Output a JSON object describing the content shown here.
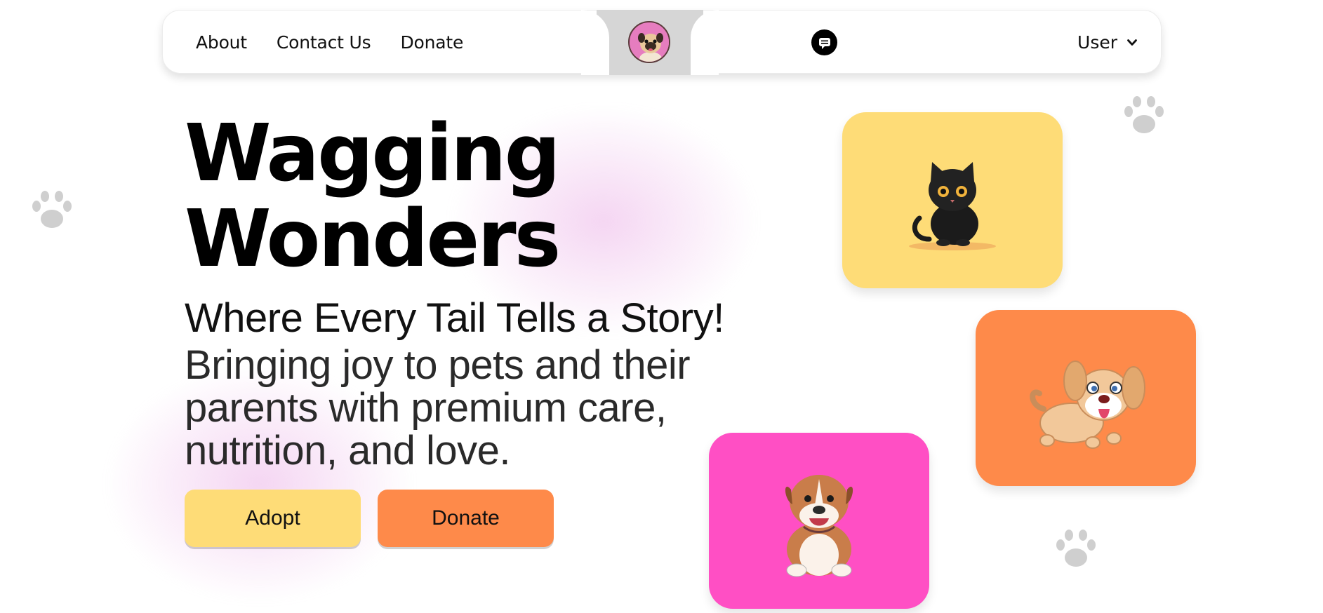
{
  "navbar": {
    "links": [
      "About",
      "Contact Us",
      "Donate"
    ],
    "logo_icon": "pug-logo-icon",
    "chat_icon": "chat-icon",
    "user_label": "User",
    "user_icon": "chevron-down-icon"
  },
  "hero": {
    "title_line1": "Wagging",
    "title_line2": "Wonders",
    "subtitle": "Where Every Tail Tells a Story!",
    "description": "Bringing joy to pets and their parents with premium care, nutrition, and love.",
    "buttons": {
      "adopt": "Adopt",
      "donate": "Donate"
    }
  },
  "cards": [
    {
      "name": "black-kitten",
      "color": "#fedc77"
    },
    {
      "name": "cartoon-puppy",
      "color": "#fe8a4a"
    },
    {
      "name": "bulldog-puppy",
      "color": "#ff4fc4"
    }
  ],
  "colors": {
    "yellow": "#fedc77",
    "orange": "#fe8a4a",
    "pink": "#ff4fc4",
    "paw": "#cfcfcf"
  }
}
